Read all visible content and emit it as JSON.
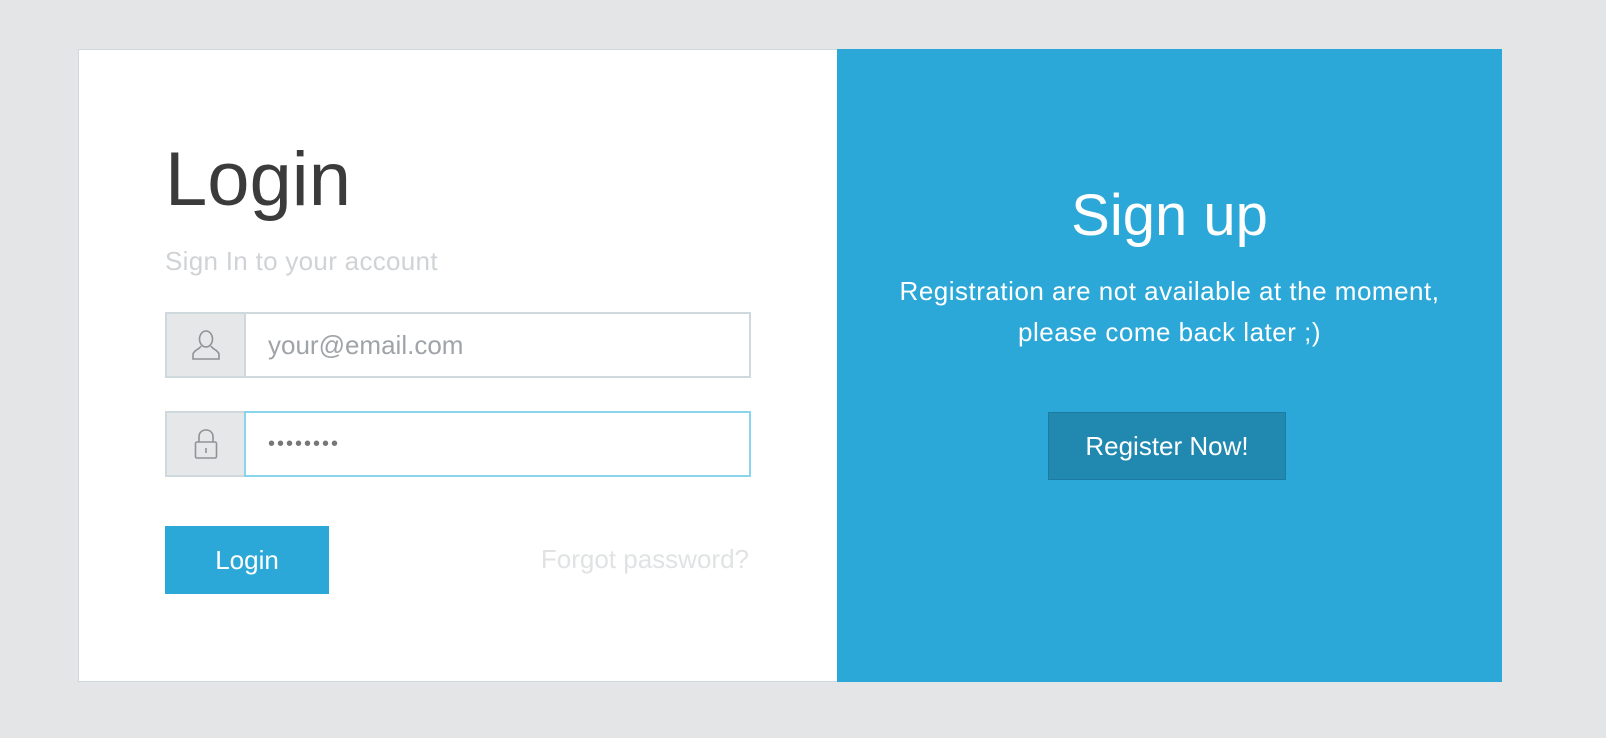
{
  "login": {
    "title": "Login",
    "subtitle": "Sign In to your account",
    "email_placeholder": "your@email.com",
    "email_value": "",
    "password_value": "••••••••",
    "submit_label": "Login",
    "forgot_label": "Forgot password?"
  },
  "signup": {
    "title": "Sign up",
    "message_line1": "Registration are not available at the moment,",
    "message_line2": "please come back later ;)",
    "button_label": "Register Now!"
  },
  "icons": {
    "email_addon": "user-icon",
    "password_addon": "lock-icon"
  },
  "colors": {
    "accent": "#2ca8d8",
    "accent_dark": "#2188b0",
    "background": "#e4e5e6"
  }
}
